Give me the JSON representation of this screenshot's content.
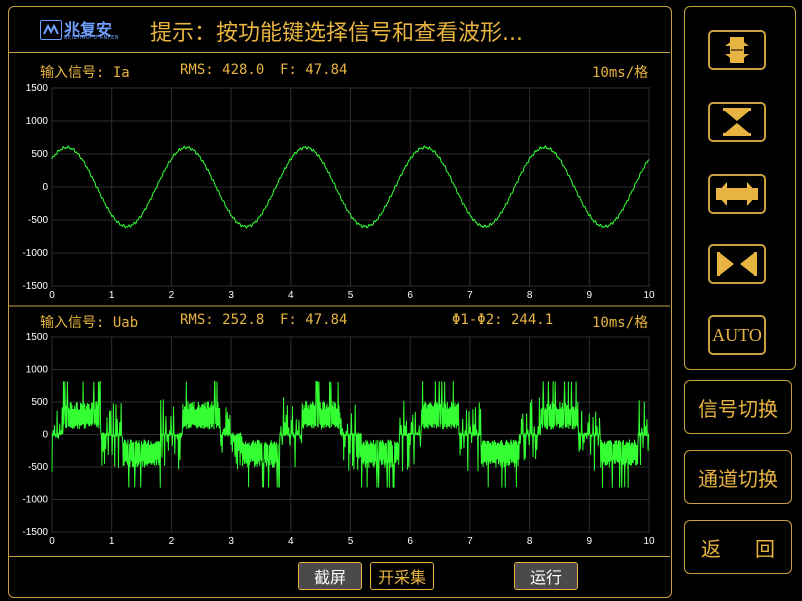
{
  "header": {
    "logo_cn": "兆复安",
    "logo_en": "BEIZHAOFU ANFEN",
    "hint": "提示：按功能键选择信号和查看波形..."
  },
  "pane1": {
    "signal_label": "输入信号: Ia",
    "rms": "RMS: 428.0",
    "freq": "F: 47.84",
    "timebase": "10ms/格",
    "y_ticks": [
      "1500",
      "1000",
      "500",
      "0",
      "-500",
      "-1000",
      "-1500"
    ],
    "x_ticks": [
      "0",
      "1",
      "2",
      "3",
      "4",
      "5",
      "6",
      "7",
      "8",
      "9",
      "10"
    ]
  },
  "pane2": {
    "signal_label": "输入信号: Uab",
    "rms": "RMS: 252.8",
    "freq": "F: 47.84",
    "phase": "Φ1-Φ2: 244.1",
    "timebase": "10ms/格",
    "y_ticks": [
      "1500",
      "1000",
      "500",
      "0",
      "-500",
      "-1000",
      "-1500"
    ],
    "x_ticks": [
      "0",
      "1",
      "2",
      "3",
      "4",
      "5",
      "6",
      "7",
      "8",
      "9",
      "10"
    ]
  },
  "right_panel": {
    "auto_label": "AUTO",
    "signal_switch": "信号切换",
    "channel_switch": "通道切换",
    "back_a": "返",
    "back_b": "回"
  },
  "bottom": {
    "screenshot": "截屏",
    "acquire": "开采集",
    "run": "运行"
  },
  "chart_data": [
    {
      "type": "line",
      "series": [
        {
          "values": "sinusoid, amplitude ~600, 5 cycles over 10 divisions"
        }
      ],
      "x": [
        0,
        1,
        2,
        3,
        4,
        5,
        6,
        7,
        8,
        9,
        10
      ],
      "xlim": [
        0,
        10
      ],
      "ylim": [
        -1500,
        1500
      ],
      "grid": true,
      "color": "#33ff33",
      "amplitude": 600,
      "cycles": 5,
      "phase_deg": 45
    },
    {
      "type": "line",
      "series": [
        {
          "values": "PWM-like square wave, plateau ~±500, spikes to ~±800, 5 cycles"
        }
      ],
      "x": [
        0,
        1,
        2,
        3,
        4,
        5,
        6,
        7,
        8,
        9,
        10
      ],
      "xlim": [
        0,
        10
      ],
      "ylim": [
        -1500,
        1500
      ],
      "grid": true,
      "color": "#33ff33",
      "amplitude": 500,
      "spike_amplitude": 820,
      "cycles": 5
    }
  ],
  "colors": {
    "accent": "#e8b441",
    "trace": "#33ff33",
    "grid": "#2e2e2e",
    "frame": "#c9a040"
  }
}
